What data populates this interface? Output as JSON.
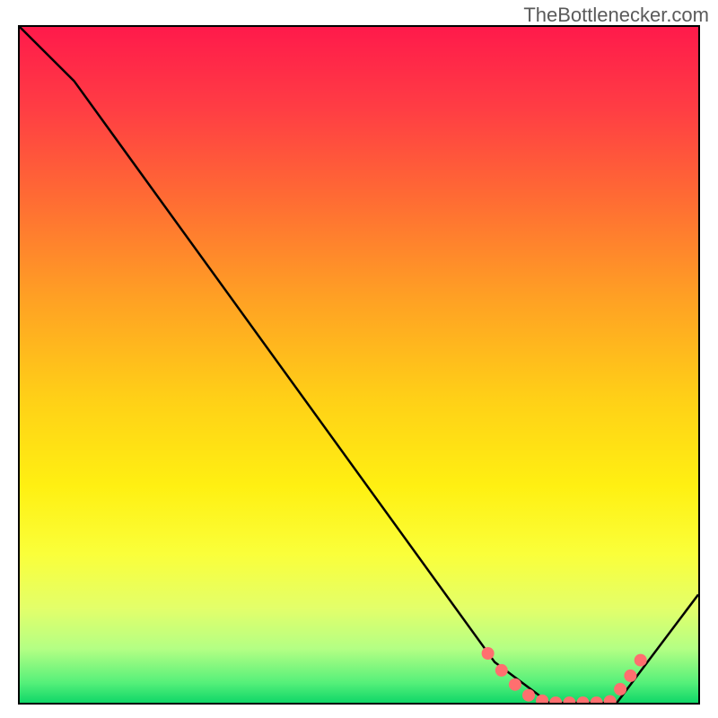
{
  "attribution": "TheBottlenecker.com",
  "chart_data": {
    "type": "line",
    "title": "",
    "xlabel": "",
    "ylabel": "",
    "xlim": [
      0,
      100
    ],
    "ylim": [
      0,
      100
    ],
    "series": [
      {
        "name": "bottleneck-curve",
        "x": [
          0,
          8,
          70,
          78,
          88,
          100
        ],
        "values": [
          100,
          92,
          6,
          0,
          0,
          16
        ]
      }
    ],
    "markers": {
      "name": "highlight-dots",
      "x": [
        69,
        71,
        73,
        75,
        77,
        79,
        81,
        83,
        85,
        87,
        88.5,
        90,
        91.5
      ],
      "values": [
        7.3,
        4.8,
        2.7,
        1.1,
        0.3,
        0.0,
        0.0,
        0.0,
        0.0,
        0.2,
        2.0,
        4.0,
        6.3
      ]
    },
    "colors": {
      "curve": "#000000",
      "marker_fill": "#ff6f6f",
      "marker_stroke": "#d94b4b",
      "gradient_top": "#ff1a4b",
      "gradient_bottom": "#10d768"
    }
  }
}
